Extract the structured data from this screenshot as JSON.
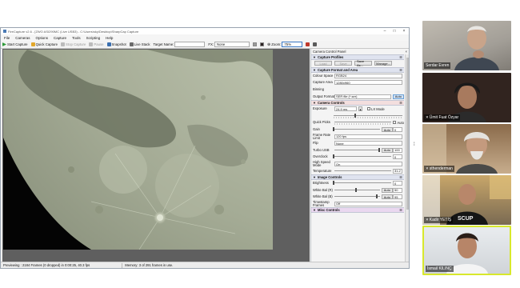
{
  "window": {
    "title": "FireCapture v2.6 - [ZWO ASI290MC (Live USB3) - C:\\Users\\sky\\Desktop\\SharpCap Capture"
  },
  "menu": [
    "File",
    "Cameras",
    "Options",
    "Capture",
    "Tools",
    "Scripting",
    "Help"
  ],
  "toolbar": {
    "start_capture": "Start Capture",
    "quick_capture": "Quick Capture",
    "stop_capture": "Stop Capture",
    "pause": "Pause",
    "snapshot": "Snapshot",
    "live_stack": "Live Stack",
    "target_name_label": "Target Name:",
    "fx_label": "FX:",
    "fx_value": "None",
    "zoom_label": "Zoom:",
    "zoom_value": "75%"
  },
  "panel": {
    "title": "Camera Control Panel",
    "sections": {
      "capture_profiles": "Capture Profiles",
      "capture_format": "Capture Format and Area",
      "camera_controls": "Camera Controls",
      "image_controls": "Image Controls",
      "misc_controls": "Misc Controls"
    },
    "profile_buttons": [
      "Load",
      "Save",
      "Save As...",
      "Manage..."
    ],
    "colour_space": {
      "label": "Colour Space",
      "value": "RGB24"
    },
    "capture_area": {
      "label": "Capture Area",
      "value": "1280x960"
    },
    "binning": {
      "label": "Binning",
      "value": ""
    },
    "output_format": {
      "label": "Output Format",
      "value": "SER file (*.ser)",
      "button": "Auto"
    },
    "exposure": {
      "label": "Exposure",
      "value": "24.9 ms",
      "lx_mode": "LX Mode",
      "auto": "Auto"
    },
    "quick_picks": {
      "label": "Quick Picks"
    },
    "gain": {
      "label": "Gain",
      "value": "0",
      "auto": "Auto",
      "level": 0.0
    },
    "frame_rate_limit": {
      "label": "Frame Rate Limit",
      "value": "120 fps"
    },
    "flip": {
      "label": "Flip",
      "value": "None"
    },
    "turbo_usb": {
      "label": "Turbo USB",
      "value": "100",
      "auto": "Auto",
      "level": 1.0
    },
    "overclock": {
      "label": "Overclock",
      "value": "0",
      "level": 0.0
    },
    "high_speed_mode": {
      "label": "High Speed Mode",
      "value": "On"
    },
    "temperature": {
      "label": "Temperature",
      "value": "31.2"
    },
    "brightness": {
      "label": "Brightness",
      "value": "0",
      "level": 0.0
    },
    "white_bal_r": {
      "label": "White Bal (R)",
      "value": "50",
      "auto": "Auto",
      "level": 0.5
    },
    "white_bal_b": {
      "label": "White Bal (B)",
      "value": "95",
      "auto": "Auto",
      "level": 0.95
    },
    "timestamp_frames": {
      "label": "Timestamp Frames",
      "value": "Off"
    }
  },
  "status": {
    "previewing": "Previewing : 2184 Frames (0 dropped) in 0:00:25, 40.3 fps",
    "memory": "Memory: 3 of 291 frames in use."
  },
  "participants": [
    {
      "name": "Serdar Evren",
      "muted": false
    },
    {
      "name": "Ümit Fuat Özyar",
      "muted": true
    },
    {
      "name": "sthenderman",
      "muted": true
    },
    {
      "name": "Kadir YETİŞ",
      "muted": true
    },
    {
      "name": "İsmail KILINÇ",
      "muted": false,
      "speaking": true
    }
  ],
  "colors": {
    "accent_blue": "#2f6fb8",
    "speaker_border": "#d8e82c",
    "section_bg": "#dfe3ef"
  }
}
